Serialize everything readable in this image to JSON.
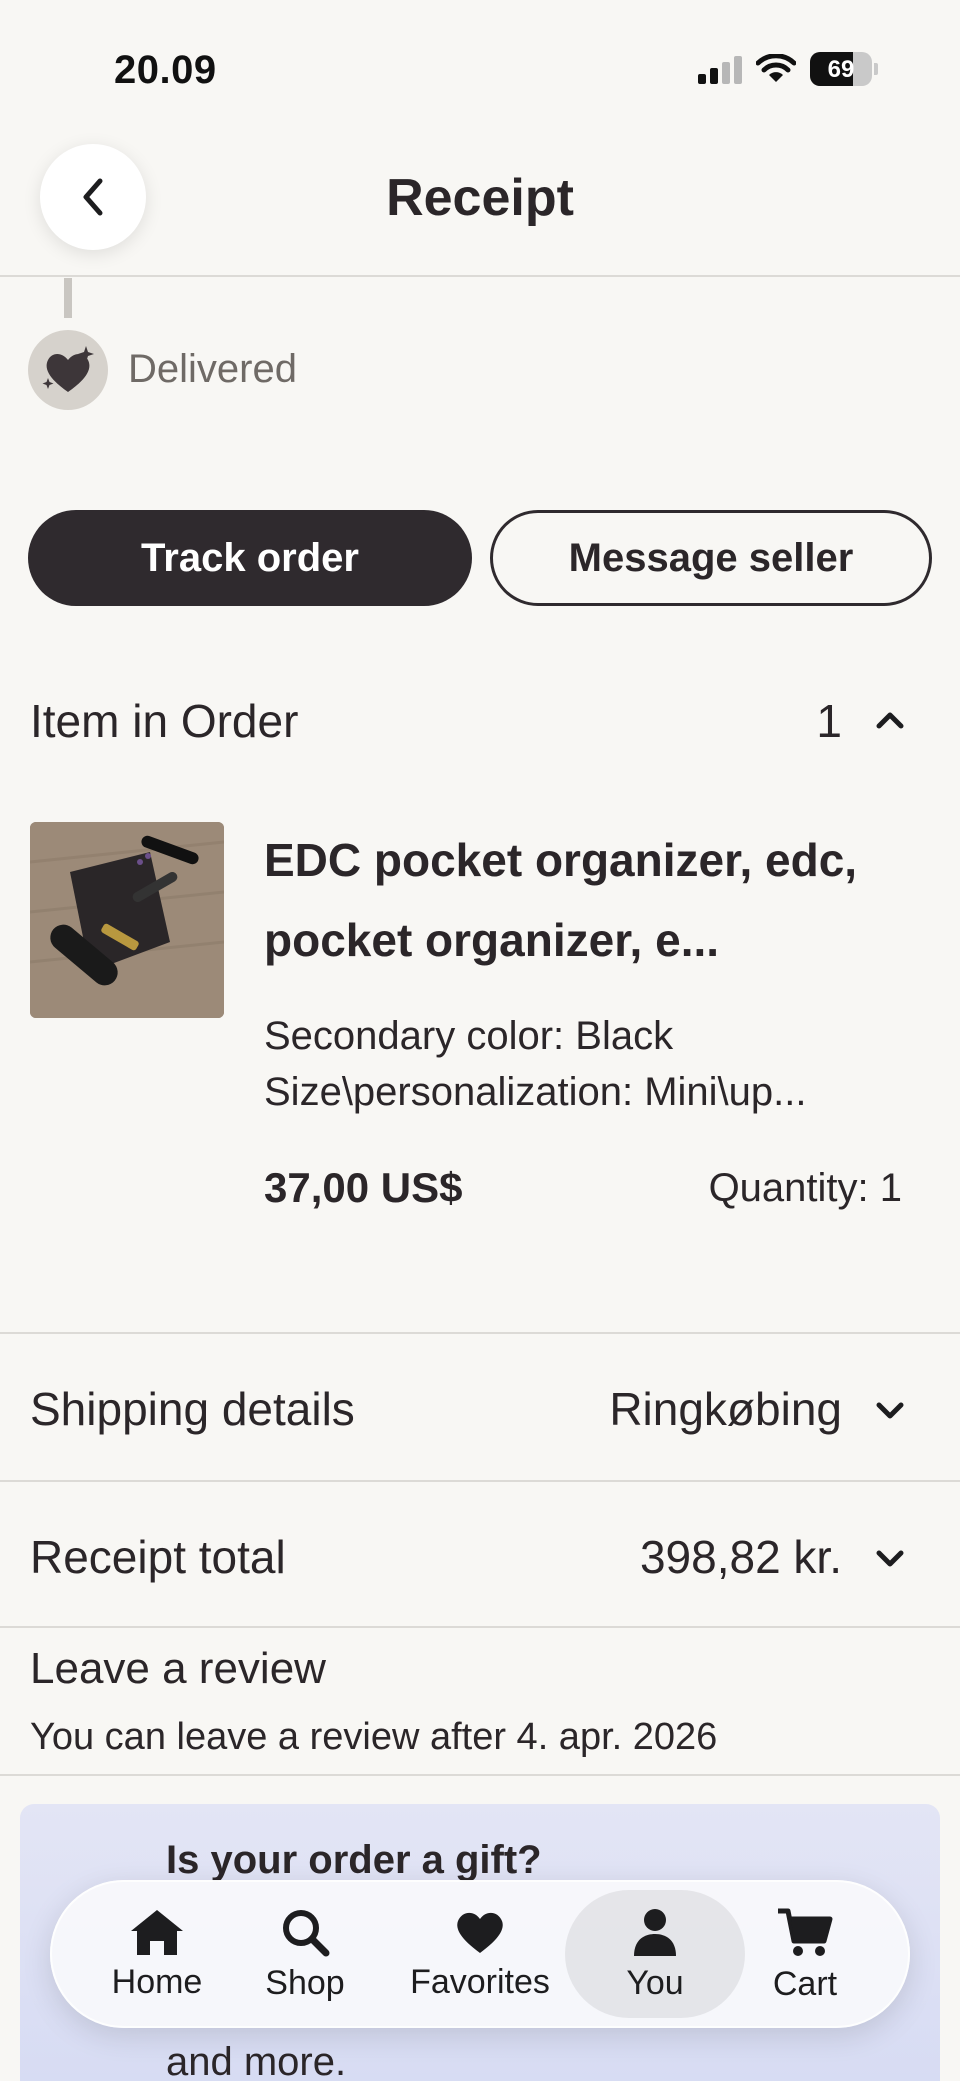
{
  "status_bar": {
    "time": "20.09",
    "battery": "69",
    "battery_level": 0.69
  },
  "header": {
    "title": "Receipt"
  },
  "order_status": {
    "label": "Delivered"
  },
  "actions": {
    "track_label": "Track order",
    "message_label": "Message seller"
  },
  "items_section": {
    "title": "Item in Order",
    "count": "1"
  },
  "product": {
    "title": "EDC pocket organizer, edc, pocket organizer, e...",
    "variant_line1": "Secondary color: Black",
    "variant_line2": "Size\\personalization: Mini\\up...",
    "price": "37,00 US$",
    "quantity": "Quantity: 1"
  },
  "shipping": {
    "label": "Shipping details",
    "value": "Ringkøbing"
  },
  "total": {
    "label": "Receipt total",
    "value": "398,82 kr."
  },
  "review": {
    "title": "Leave a review",
    "note": "You can leave a review after 4. apr. 2026"
  },
  "gift": {
    "title": "Is your order a gift?",
    "body": "and more."
  },
  "tabs": [
    {
      "label": "Home",
      "icon": "home-icon"
    },
    {
      "label": "Shop",
      "icon": "search-icon"
    },
    {
      "label": "Favorites",
      "icon": "heart-icon"
    },
    {
      "label": "You",
      "icon": "person-icon",
      "selected": true
    },
    {
      "label": "Cart",
      "icon": "cart-icon"
    }
  ],
  "colors": {
    "primary_dark": "#2f2a2e",
    "background": "#f8f7f4",
    "gift_card": "#dde0f4"
  }
}
